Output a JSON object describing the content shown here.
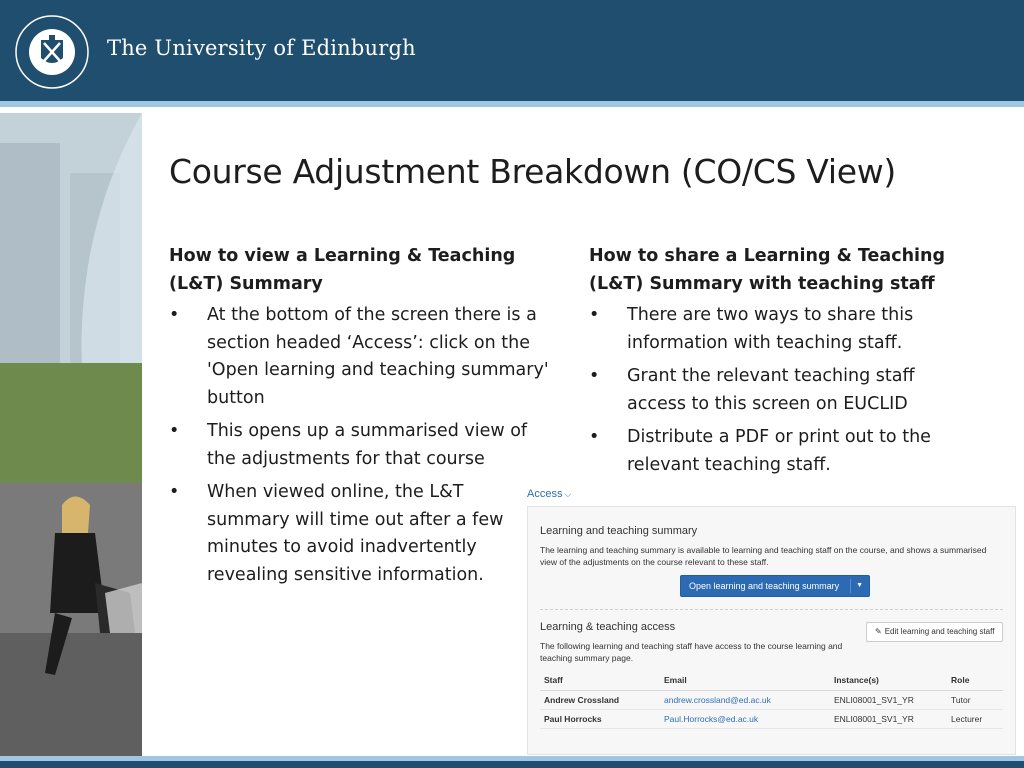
{
  "header": {
    "university_name": "The University of Edinburgh",
    "seal_text": "THE UNIVERSITY OF EDINBURGH"
  },
  "title": "Course Adjustment Breakdown (CO/CS View)",
  "left_column": {
    "heading_line1": "How to view a Learning & Teaching",
    "heading_line2": "(L&T) Summary",
    "bullets": [
      "At the bottom of the screen there is a section headed ‘Access’: click on the 'Open learning and teaching summary' button",
      "This opens up a summarised view of the adjustments for that course",
      "When viewed online, the L&T summary will time out after a few minutes to avoid inadvertently revealing sensitive information."
    ]
  },
  "right_column": {
    "heading_line1": "How to share a Learning & Teaching",
    "heading_line2": "(L&T) Summary with teaching staff",
    "bullets": [
      "There are two ways to share this information with teaching staff.",
      "Grant the relevant teaching staff access to this screen on EUCLID",
      "Distribute a PDF or print out to the relevant teaching staff."
    ]
  },
  "access_panel": {
    "toggle_label": "Access",
    "summary_heading": "Learning and teaching summary",
    "summary_text": "The learning and teaching summary is available to learning and teaching staff on the course, and shows a summarised view of the adjustments on the course relevant to these staff.",
    "open_button_label": "Open learning and teaching summary",
    "access_heading": "Learning & teaching access",
    "access_text": "The following learning and teaching staff have access to the course learning and teaching summary page.",
    "edit_button_label": "Edit learning and teaching staff",
    "table": {
      "headers": [
        "Staff",
        "Email",
        "Instance(s)",
        "Role"
      ],
      "rows": [
        [
          "Andrew Crossland",
          "andrew.crossland@ed.ac.uk",
          "ENLI08001_SV1_YR",
          "Tutor"
        ],
        [
          "Paul Horrocks",
          "Paul.Horrocks@ed.ac.uk",
          "ENLI08001_SV1_YR",
          "Lecturer"
        ]
      ]
    }
  },
  "colors": {
    "header_blue": "#1f4e6f",
    "stripe_light_blue": "#9fc6e4",
    "button_blue": "#2c6bb4",
    "link_blue": "#2f6db5"
  },
  "icons": {
    "seal": "university-crest-icon",
    "toggle": "chevron-down-icon",
    "caret": "caret-down-icon",
    "edit": "pencil-icon"
  }
}
